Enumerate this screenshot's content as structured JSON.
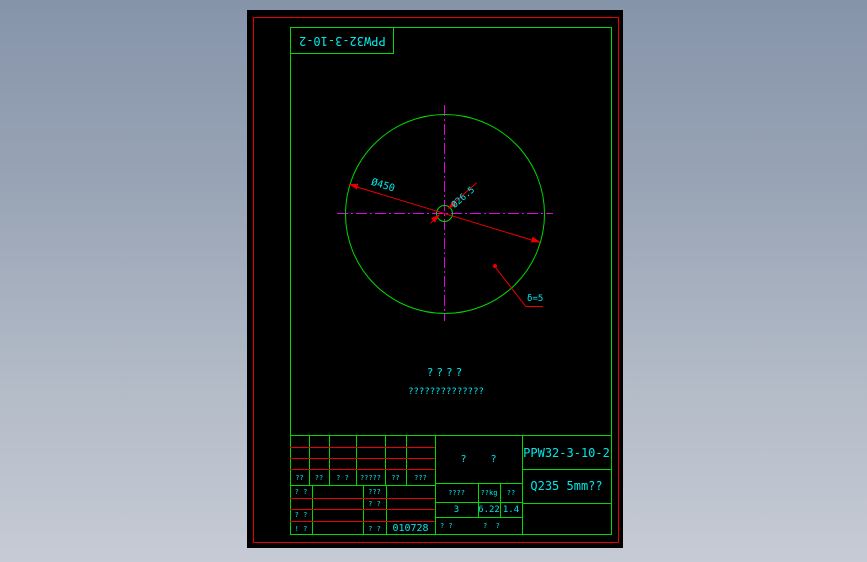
{
  "drawing": {
    "top_label_mirrored": "PPW32-3-10-2",
    "dim_outer_diameter": "Ø450",
    "dim_inner_diameter": "Ø26.5",
    "dim_thickness": "δ=5",
    "center_note_line1": "????",
    "center_note_line2": "??????????????"
  },
  "title_block": {
    "part_number": "PPW32-3-10-2",
    "material_spec": "Q235 5mm??",
    "middle_title": "?    ?",
    "revision_headers": [
      "??",
      "??",
      "? ?",
      "?????",
      "??",
      "???"
    ],
    "sig_row1_col1": "? ?",
    "sig_row1_col3": "???",
    "sig_row2_col3": "? ?",
    "sig_row3_col1": "? ?",
    "sig_row4_col1": "! ?",
    "sig_row4_col3": "? ?",
    "sig_row4_date": "010728",
    "qty_header": "????",
    "weight_header": "??kg",
    "scale_header": "??",
    "qty_value": "3",
    "weight_value": "6.22",
    "scale_value": "1.4",
    "bottom_left": "? ?",
    "bottom_right": "?  ?"
  },
  "colors": {
    "line_green": "#00d900",
    "dim_red": "#e80000",
    "center_magenta": "#e800e8",
    "text_cyan": "#00e8e8",
    "paper_black": "#000000"
  }
}
